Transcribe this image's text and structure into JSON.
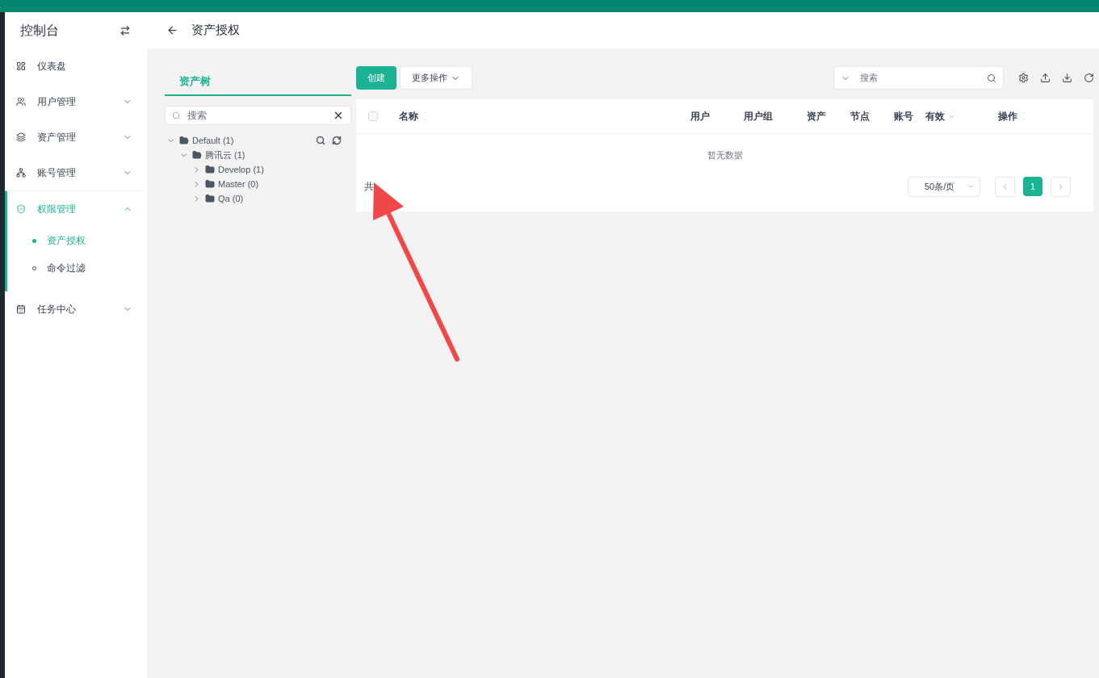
{
  "sidebar": {
    "title": "控制台",
    "items": [
      {
        "label": "仪表盘",
        "selected": false
      },
      {
        "label": "用户管理",
        "expanded": false,
        "selected": false
      },
      {
        "label": "资产管理",
        "expanded": false,
        "selected": false
      },
      {
        "label": "账号管理",
        "expanded": false,
        "selected": false
      },
      {
        "label": "权限管理",
        "expanded": true,
        "selected": true,
        "children": [
          {
            "label": "资产授权",
            "selected": true
          },
          {
            "label": "命令过滤",
            "selected": false
          }
        ]
      },
      {
        "label": "任务中心",
        "expanded": false,
        "selected": false
      }
    ]
  },
  "page_title": "资产授权",
  "tree_panel": {
    "tab": "资产树",
    "search": {
      "placeholder": "搜索"
    },
    "tree": [
      {
        "label": "Default (1)",
        "expanded": true,
        "children": [
          {
            "label": "腾讯云 (1)",
            "expanded": true,
            "children": [
              {
                "label": "Develop (1)",
                "expanded": false
              },
              {
                "label": "Master (0)",
                "expanded": false
              },
              {
                "label": "Qa (0)",
                "expanded": false
              }
            ]
          }
        ]
      }
    ]
  },
  "toolbar": {
    "create": "创建",
    "more": "更多操作",
    "search": {
      "placeholder": "搜索"
    }
  },
  "table": {
    "columns": [
      "名称",
      "用户",
      "用户组",
      "资产",
      "节点",
      "账号",
      "有效",
      "操作"
    ],
    "empty": "暂无数据",
    "select_all": {
      "checked": false
    }
  },
  "footer": {
    "total": "共",
    "page_size": "50条/页",
    "pages": [
      {
        "label": "1",
        "selected": true
      }
    ]
  }
}
